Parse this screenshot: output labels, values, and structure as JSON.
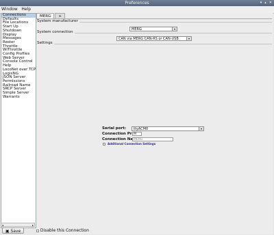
{
  "window": {
    "title": "Preferences",
    "controls": [
      "▾",
      "▴",
      "✕"
    ]
  },
  "menu": [
    "Window",
    "Help"
  ],
  "sidebar": {
    "items": [
      "Connections",
      "Defaults",
      "File Locations",
      "Start Up",
      "Shutdown",
      "Display",
      "Messages",
      "Roster",
      "Throttle",
      "WiThrottle",
      "Config Profiles",
      "Web Server",
      "Console Control",
      "Help",
      "LocoNet over TCP S",
      "LogixNG",
      "JSON Server",
      "Permissions",
      "Railroad Name",
      "SRCP Server",
      "Simple Server",
      "Warrants"
    ],
    "selected": 0
  },
  "save_label": "Save",
  "tabs": [
    {
      "label": "MERG"
    },
    {
      "label": "+"
    }
  ],
  "system_manufacturer": {
    "title": "System manufacturer",
    "value": "MERG"
  },
  "system_connection": {
    "title": "System connection",
    "value": "CAN via MERG CAN-RS or CAN-USB"
  },
  "settings": {
    "title": "Settings"
  },
  "form": {
    "serial_port_label": "Serial port:",
    "serial_port_value": "ttyACM0",
    "profile_label": "Connection Prefix:",
    "profile_value": "M",
    "name_label": "Connection Name:",
    "name_value": "MERG",
    "additional_label": "Additional Connection Settings"
  },
  "disable_label": "Disable this Connection"
}
